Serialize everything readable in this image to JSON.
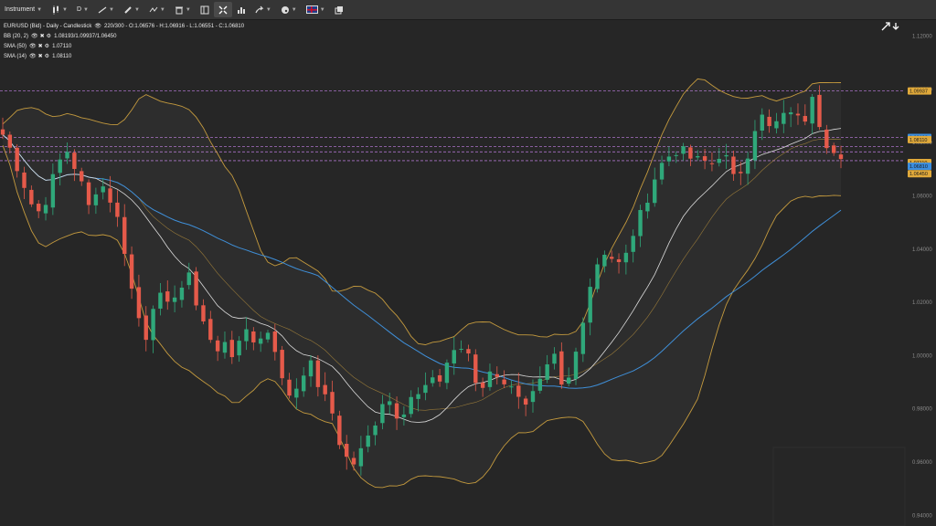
{
  "toolbar": {
    "instrument_label": "Instrument",
    "timeframe_label": "D"
  },
  "legend": {
    "title": "EUR/USD (Bid) - Daily - Candlestick",
    "info": "220/300 - O:1.06576 - H:1.06916 - L:1.06551 - C:1.06810",
    "bb_name": "BB (20, 2)",
    "bb_values": "1.08193/1.09937/1.06450",
    "sma50_name": "SMA (50)",
    "sma50_value": "1.07110",
    "sma14_name": "SMA (14)",
    "sma14_value": "1.08110"
  },
  "colors": {
    "background": "#262626",
    "toolbar": "#353535",
    "bull": "#2fa87a",
    "bear": "#e55a4a",
    "bollinger": "#c49a3e",
    "sma50": "#3f8fd8",
    "sma14": "#dcdcdc",
    "hline": "#b87ad8"
  },
  "chart_data": {
    "type": "candlestick",
    "instrument": "EUR/USD (Bid)",
    "timeframe": "Daily",
    "y_ticks": [
      "1.12000",
      "1.10000",
      "1.08000",
      "1.06000",
      "1.04000",
      "1.02000",
      "1.00000",
      "0.98000",
      "0.96000",
      "0.94000"
    ],
    "ylim": [
      0.936,
      1.126
    ],
    "grid": false,
    "horizontal_lines": [
      1.09937,
      1.08193,
      1.0785,
      1.0765,
      1.0732
    ],
    "price_labels": [
      {
        "text": "1.09937",
        "value": 1.09937,
        "color": "#e0a93a"
      },
      {
        "text": "1.08193",
        "value": 1.08193,
        "color": "#3b8ee0"
      },
      {
        "text": "1.08110",
        "value": 1.0811,
        "color": "#e0a93a"
      },
      {
        "text": "1.07110",
        "value": 1.0725,
        "color": "#e0a93a"
      },
      {
        "text": "1.06810",
        "value": 1.0711,
        "color": "#3b8ee0"
      },
      {
        "text": "1.06450",
        "value": 1.0683,
        "color": "#e0a93a"
      }
    ],
    "close_anchors": [
      [
        0,
        1.0845
      ],
      [
        8,
        1.0805
      ],
      [
        16,
        1.073
      ],
      [
        24,
        1.0665
      ],
      [
        32,
        1.0585
      ],
      [
        40,
        1.0535
      ],
      [
        48,
        1.056
      ],
      [
        56,
        1.065
      ],
      [
        64,
        1.072
      ],
      [
        72,
        1.078
      ],
      [
        80,
        1.072
      ],
      [
        88,
        1.066
      ],
      [
        96,
        1.055
      ],
      [
        104,
        1.062
      ],
      [
        112,
        1.064
      ],
      [
        120,
        1.059
      ],
      [
        128,
        1.052
      ],
      [
        136,
        1.04
      ],
      [
        144,
        1.025
      ],
      [
        152,
        1.014
      ],
      [
        160,
        1.007
      ],
      [
        168,
        1.02
      ],
      [
        176,
        1.022
      ],
      [
        184,
        1.018
      ],
      [
        192,
        1.024
      ],
      [
        200,
        1.026
      ],
      [
        208,
        1.03
      ],
      [
        216,
        1.018
      ],
      [
        224,
        1.012
      ],
      [
        232,
        1.004
      ],
      [
        240,
        1.0
      ],
      [
        248,
        1.008
      ],
      [
        256,
        0.998
      ],
      [
        264,
        1.006
      ],
      [
        272,
        1.012
      ],
      [
        280,
        1.003
      ],
      [
        288,
        1.008
      ],
      [
        296,
        1.01
      ],
      [
        304,
        0.998
      ],
      [
        312,
        0.985
      ],
      [
        320,
        0.986
      ],
      [
        328,
        0.99
      ],
      [
        336,
        0.998
      ],
      [
        344,
        0.995
      ],
      [
        352,
        0.983
      ],
      [
        360,
        0.985
      ],
      [
        368,
        0.97
      ],
      [
        376,
        0.964
      ],
      [
        384,
        0.958
      ],
      [
        392,
        0.962
      ],
      [
        400,
        0.968
      ],
      [
        408,
        0.972
      ],
      [
        416,
        0.982
      ],
      [
        424,
        0.985
      ],
      [
        432,
        0.978
      ],
      [
        440,
        0.978
      ],
      [
        448,
        0.985
      ],
      [
        456,
        0.984
      ],
      [
        464,
        0.988
      ],
      [
        472,
        0.99
      ],
      [
        480,
        0.99
      ],
      [
        488,
        0.997
      ],
      [
        496,
        1.002
      ],
      [
        504,
        1.003
      ],
      [
        512,
        1.0
      ],
      [
        520,
        0.99
      ],
      [
        528,
        0.988
      ],
      [
        536,
        0.995
      ],
      [
        544,
        0.993
      ],
      [
        552,
        0.988
      ],
      [
        560,
        0.99
      ],
      [
        568,
        0.985
      ],
      [
        576,
        0.98
      ],
      [
        584,
        0.986
      ],
      [
        592,
        0.99
      ],
      [
        600,
        0.996
      ],
      [
        608,
        1.0
      ],
      [
        616,
        0.985
      ],
      [
        624,
        0.993
      ],
      [
        632,
        1.004
      ],
      [
        640,
        1.018
      ],
      [
        648,
        1.03
      ],
      [
        656,
        1.037
      ],
      [
        664,
        1.04
      ],
      [
        672,
        1.035
      ],
      [
        680,
        1.034
      ],
      [
        688,
        1.04
      ],
      [
        696,
        1.05
      ],
      [
        704,
        1.055
      ],
      [
        712,
        1.063
      ],
      [
        720,
        1.07
      ],
      [
        728,
        1.074
      ],
      [
        736,
        1.076
      ],
      [
        744,
        1.078
      ],
      [
        752,
        1.075
      ],
      [
        760,
        1.073
      ],
      [
        768,
        1.074
      ],
      [
        776,
        1.071
      ],
      [
        784,
        1.074
      ],
      [
        792,
        1.078
      ],
      [
        800,
        1.066
      ],
      [
        808,
        1.068
      ],
      [
        816,
        1.073
      ],
      [
        824,
        1.084
      ],
      [
        832,
        1.091
      ],
      [
        840,
        1.085
      ],
      [
        848,
        1.087
      ],
      [
        856,
        1.089
      ],
      [
        864,
        1.093
      ],
      [
        872,
        1.089
      ],
      [
        880,
        1.088
      ],
      [
        888,
        1.1
      ],
      [
        896,
        1.088
      ],
      [
        904,
        1.08
      ],
      [
        912,
        1.076
      ],
      [
        920,
        1.0725
      ]
    ],
    "indicators": [
      "BB (20, 2)",
      "SMA (50)",
      "SMA (14)"
    ]
  }
}
